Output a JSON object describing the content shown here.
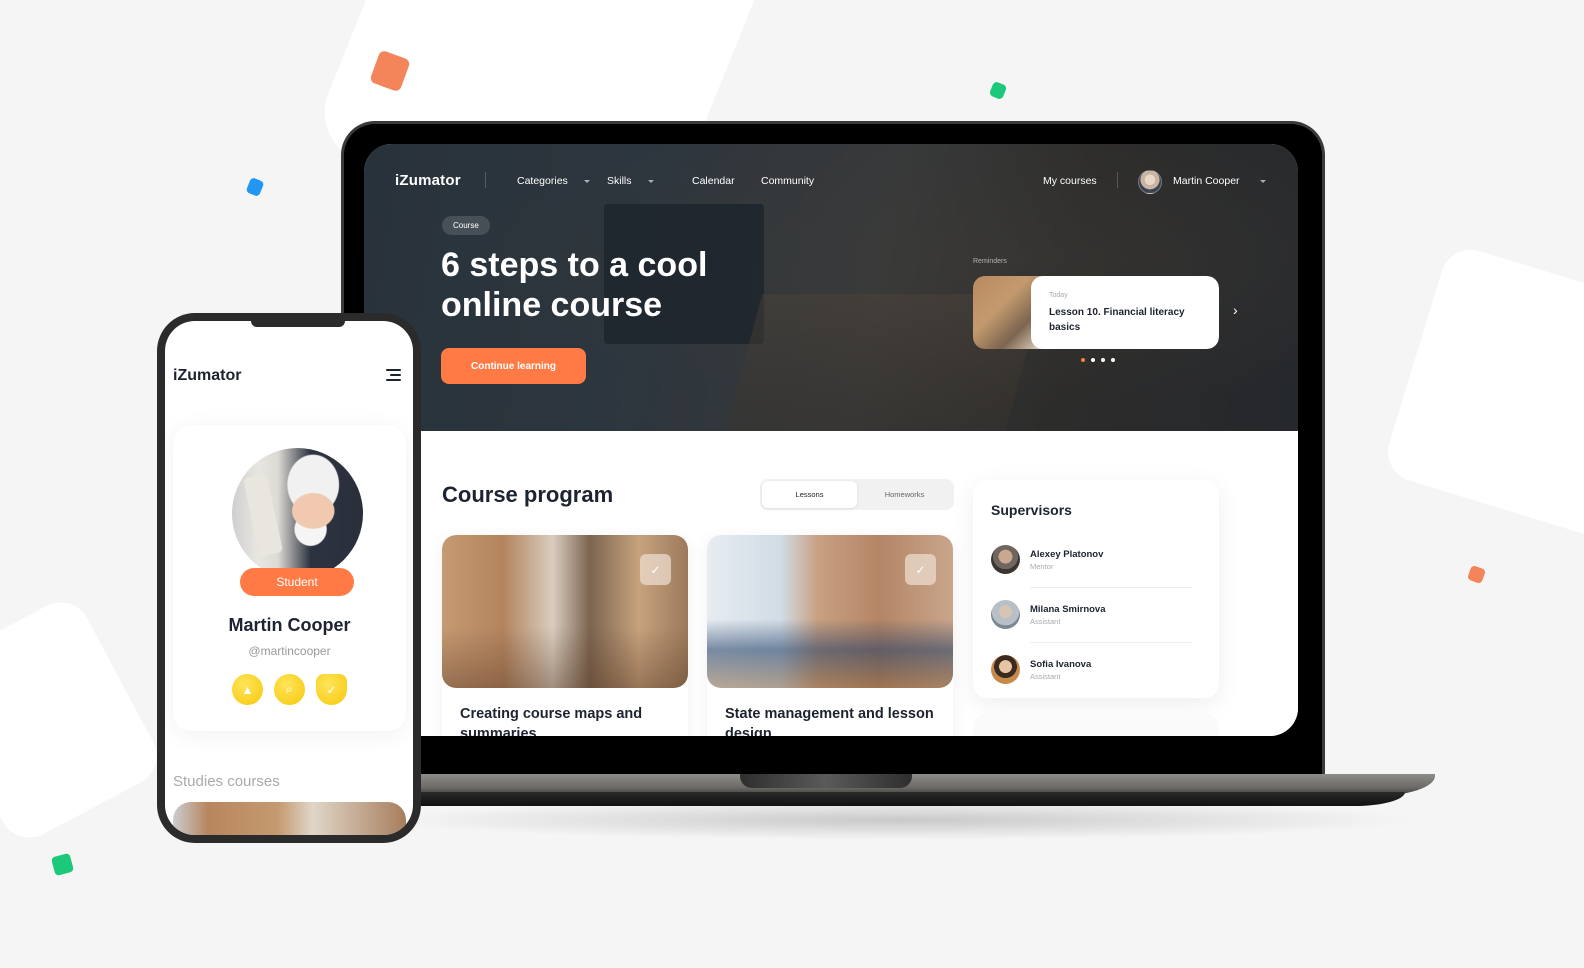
{
  "colors": {
    "accent": "#ff7a45",
    "text_dark": "#1d2330",
    "badge_yellow": "#f7c70a",
    "deco_blue": "#2196f3",
    "deco_green": "#1cc87a",
    "deco_orange": "#f4845a"
  },
  "laptop": {
    "nav": {
      "logo": "iZumator",
      "items": [
        {
          "label": "Categories",
          "has_dropdown": true
        },
        {
          "label": "Skills",
          "has_dropdown": true
        },
        {
          "label": "Calendar",
          "has_dropdown": false
        },
        {
          "label": "Community",
          "has_dropdown": false
        }
      ],
      "my_courses": "My courses",
      "user_name": "Martin Cooper"
    },
    "hero": {
      "tag": "Course",
      "title": "6 steps to a cool online course",
      "cta": "Continue learning"
    },
    "reminders": {
      "label": "Reminders",
      "card": {
        "when": "Today",
        "title": "Lesson 10. Financial literacy basics"
      },
      "next_icon": "›",
      "pages": 4,
      "active_page": 1
    },
    "course_program": {
      "title": "Course program",
      "tabs": [
        {
          "label": "Lessons",
          "active": true
        },
        {
          "label": "Homeworks",
          "active": false
        }
      ],
      "courses": [
        {
          "title": "Creating course maps and summaries",
          "completed": true
        },
        {
          "title": "State management and lesson design",
          "completed": true
        }
      ]
    },
    "supervisors": {
      "title": "Supervisors",
      "people": [
        {
          "name": "Alexey Platonov",
          "role": "Mentor"
        },
        {
          "name": "Milana Smirnova",
          "role": "Assistant"
        },
        {
          "name": "Sofia Ivanova",
          "role": "Assistant"
        }
      ]
    }
  },
  "phone": {
    "logo": "iZumator",
    "profile": {
      "role": "Student",
      "name": "Martin Cooper",
      "handle": "@martincooper",
      "badges": [
        "graduation-cap-badge",
        "search-badge",
        "shield-check-badge"
      ]
    },
    "studies_label": "Studies courses"
  },
  "icons": {
    "check": "✓",
    "cap": "🎓",
    "search": "⌕"
  }
}
